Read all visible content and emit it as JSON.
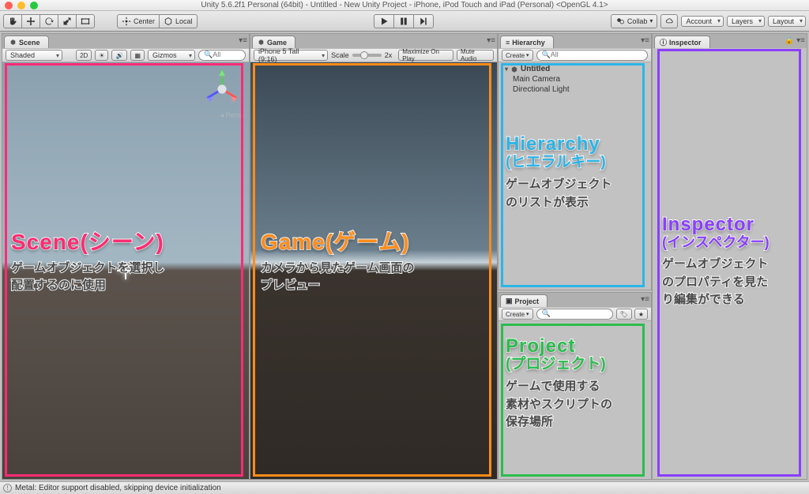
{
  "titlebar": {
    "title": "Unity 5.6.2f1 Personal (64bit) - Untitled - New Unity Project - iPhone, iPod Touch and iPad (Personal) <OpenGL 4.1>"
  },
  "toolbar": {
    "pivot_center": "Center",
    "pivot_local": "Local",
    "collab": "Collab",
    "account": "Account",
    "layers": "Layers",
    "layout": "Layout"
  },
  "scene": {
    "tab": "Scene",
    "shading": "Shaded",
    "mode2d": "2D",
    "gizmos": "Gizmos",
    "axes": {
      "x": "x",
      "y": "y",
      "z": "z"
    },
    "persp": "Persp"
  },
  "game": {
    "tab": "Game",
    "display": "iPhone 5 Tall (9:16)",
    "scale_label": "Scale",
    "scale_value": "2x",
    "maximize": "Maximize On Play",
    "mute": "Mute Audio"
  },
  "hierarchy": {
    "tab": "Hierarchy",
    "create": "Create",
    "scene_name": "Untitled",
    "items": [
      "Main Camera",
      "Directional Light"
    ]
  },
  "project": {
    "tab": "Project",
    "create": "Create"
  },
  "inspector": {
    "tab": "Inspector"
  },
  "status": {
    "msg": "Metal: Editor support disabled, skipping device initialization"
  },
  "annotations": {
    "scene": {
      "title": "Scene(シーン)",
      "desc": "ゲームオブジェクトを選択し\n配置するのに使用"
    },
    "game": {
      "title": "Game(ゲーム)",
      "desc": "カメラから見たゲーム画面の\nプレビュー"
    },
    "hierarchy": {
      "title": "Hierarchy",
      "sub": "(ヒエラルキー)",
      "desc": "ゲームオブジェクト\nのリストが表示"
    },
    "project": {
      "title": "Project",
      "sub": "(プロジェクト)",
      "desc": "ゲームで使用する\n素材やスクリプトの\n保存場所"
    },
    "inspector": {
      "title": "Inspector",
      "sub": "(インスペクター)",
      "desc": "ゲームオブジェクト\nのプロパティを見た\nり編集ができる"
    }
  }
}
